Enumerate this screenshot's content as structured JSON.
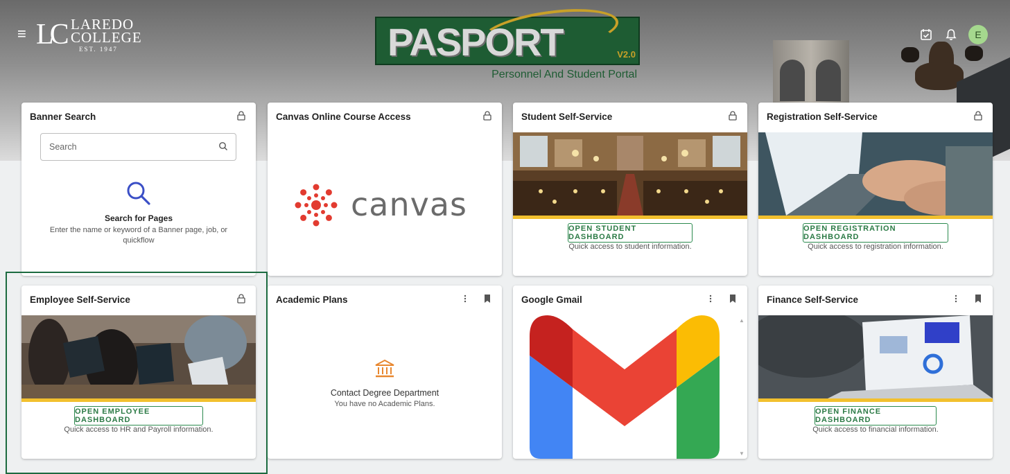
{
  "header": {
    "menu_icon": "hamburger-menu-icon",
    "logo": {
      "mark": "L",
      "mark2": "C",
      "line1": "LAREDO",
      "line2": "COLLEGE",
      "est": "EST. 1947"
    },
    "portal_logo": {
      "word": "PASPORT",
      "version": "V2.0",
      "subtitle": "Personnel And Student Portal"
    },
    "icons": [
      "calendar-check-icon",
      "bell-icon"
    ],
    "avatar_initial": "E",
    "avatar_color": "#a5d88e"
  },
  "cards": {
    "banner_search": {
      "title": "Banner Search",
      "search_placeholder": "Search",
      "heading": "Search for Pages",
      "description": "Enter the name or keyword of a Banner page, job, or quickflow"
    },
    "canvas": {
      "title": "Canvas Online Course Access",
      "brand": "canvas"
    },
    "student": {
      "title": "Student Self-Service",
      "button": "OPEN STUDENT DASHBOARD",
      "description": "Quick access to student information."
    },
    "registration": {
      "title": "Registration Self-Service",
      "button": "OPEN REGISTRATION DASHBOARD",
      "description": "Quick access to registration information."
    },
    "employee": {
      "title": "Employee Self-Service",
      "button": "OPEN EMPLOYEE DASHBOARD",
      "description": "Quick access to HR and Payroll information."
    },
    "academic": {
      "title": "Academic Plans",
      "heading": "Contact Degree Department",
      "description": "You have no Academic Plans."
    },
    "gmail": {
      "title": "Google Gmail"
    },
    "finance": {
      "title": "Finance Self-Service",
      "button": "OPEN FINANCE DASHBOARD",
      "description": "Quick access to financial information."
    }
  },
  "colors": {
    "accent_green": "#2b7a45",
    "gold_bar": "#f2c02e",
    "highlight": "#1c6b40",
    "canvas_red": "#e23b30"
  }
}
